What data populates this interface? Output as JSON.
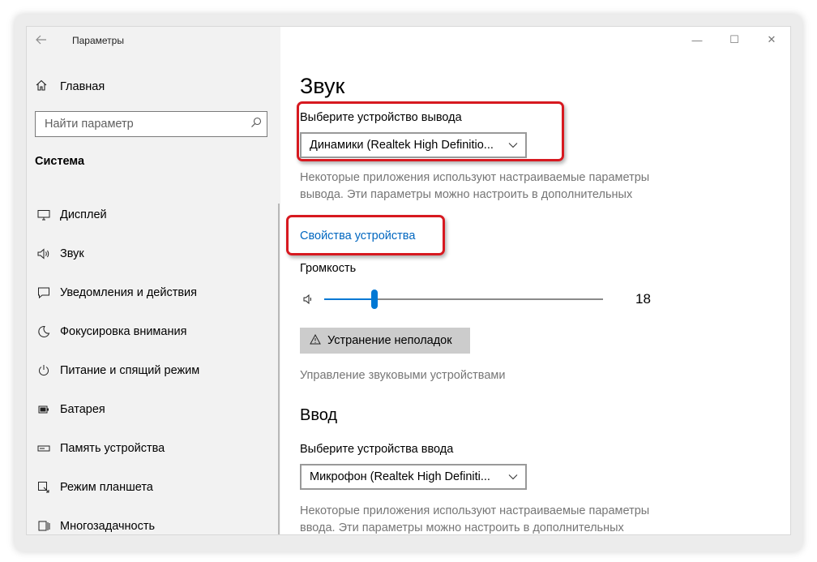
{
  "window": {
    "app_title": "Параметры",
    "controls": {
      "minimize": "—",
      "maximize": "☐",
      "close": "✕"
    }
  },
  "sidebar": {
    "home_label": "Главная",
    "search_placeholder": "Найти параметр",
    "section_title": "Система",
    "items": [
      {
        "label": "Дисплей",
        "icon": "monitor-icon"
      },
      {
        "label": "Звук",
        "icon": "speaker-icon"
      },
      {
        "label": "Уведомления и действия",
        "icon": "notification-icon"
      },
      {
        "label": "Фокусировка внимания",
        "icon": "moon-icon"
      },
      {
        "label": "Питание и спящий режим",
        "icon": "power-icon"
      },
      {
        "label": "Батарея",
        "icon": "battery-icon"
      },
      {
        "label": "Память устройства",
        "icon": "storage-icon"
      },
      {
        "label": "Режим планшета",
        "icon": "tablet-icon"
      },
      {
        "label": "Многозадачность",
        "icon": "multitask-icon"
      }
    ]
  },
  "main": {
    "title": "Звук",
    "output": {
      "label": "Выберите устройство вывода",
      "selected": "Динамики (Realtek High Definitio...",
      "description": "Некоторые приложения используют настраиваемые параметры вывода. Эти параметры можно настроить в дополнительных настройках звука.",
      "device_properties_link": "Свойства устройства"
    },
    "volume": {
      "label": "Громкость",
      "value": 18,
      "value_text": "18"
    },
    "troubleshoot_label": "Устранение неполадок",
    "manage_devices_link": "Управление звуковыми устройствами",
    "input": {
      "heading": "Ввод",
      "label": "Выберите устройства ввода",
      "selected": "Микрофон (Realtek High Definiti...",
      "description": "Некоторые приложения используют настраиваемые параметры ввода. Эти параметры можно настроить в дополнительных"
    }
  },
  "colors": {
    "accent": "#0078d4",
    "link": "#0067c0",
    "highlight": "#d71920",
    "sidebar_bg": "#f2f2f2"
  }
}
